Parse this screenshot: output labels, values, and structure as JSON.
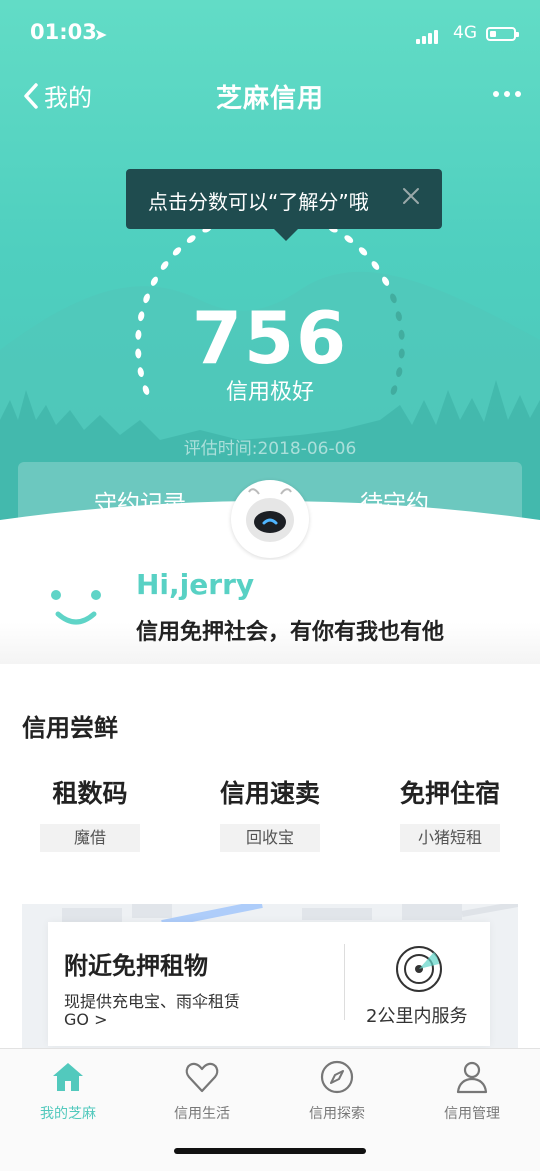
{
  "status_bar": {
    "time": "01:03",
    "network": "4G"
  },
  "nav": {
    "back_label": "我的",
    "title": "芝麻信用"
  },
  "tooltip": {
    "text": "点击分数可以“了解分”哦"
  },
  "score": {
    "value": "756",
    "level": "信用极好",
    "eval_time": "评估时间:2018-06-06"
  },
  "record_tabs": {
    "left": "守约记录",
    "right": "待守约"
  },
  "greeting": {
    "hi": "Hi,jerry",
    "slogan": "信用免押社会，有你有我也有他"
  },
  "credit_section": {
    "title": "信用尝鲜",
    "cards": [
      {
        "title": "租数码",
        "tag": "魔借"
      },
      {
        "title": "信用速卖",
        "tag": "回收宝"
      },
      {
        "title": "免押住宿",
        "tag": "小猪短租"
      }
    ]
  },
  "nearby": {
    "title": "附近免押租物",
    "desc": "现提供充电宝、雨伞租赁",
    "go": "GO >",
    "service": "2公里内服务"
  },
  "tabbar": [
    {
      "label": "我的芝麻",
      "icon": "home-icon",
      "active": true
    },
    {
      "label": "信用生活",
      "icon": "heart-icon",
      "active": false
    },
    {
      "label": "信用探索",
      "icon": "compass-icon",
      "active": false
    },
    {
      "label": "信用管理",
      "icon": "person-icon",
      "active": false
    }
  ],
  "colors": {
    "accent": "#52c9bd",
    "tooltip_bg": "#1f4c4f"
  }
}
